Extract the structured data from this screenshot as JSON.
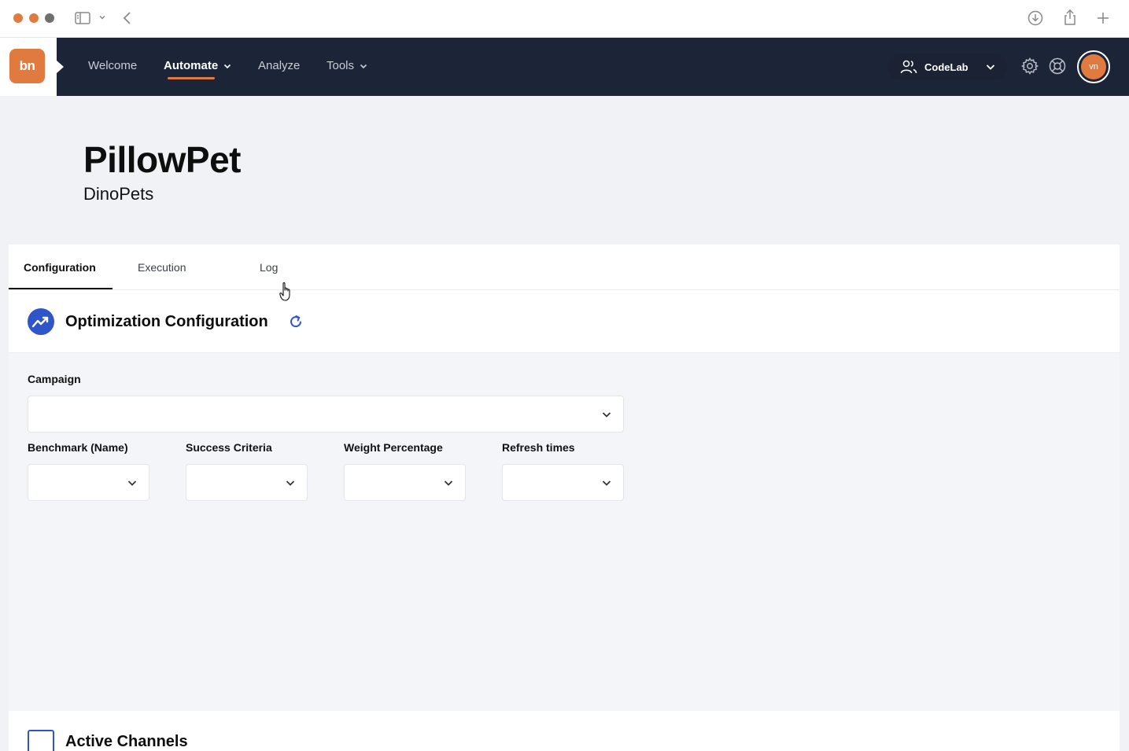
{
  "browser": {
    "icons": [
      "sidebar-toggle-icon",
      "chevron-down-icon",
      "back-arrow-icon",
      "download-icon",
      "share-icon",
      "new-tab-plus-icon"
    ]
  },
  "nav": {
    "logo_text": "bn",
    "items": [
      {
        "label": "Welcome",
        "active": false,
        "has_dropdown": false
      },
      {
        "label": "Automate",
        "active": true,
        "has_dropdown": true
      },
      {
        "label": "Analyze",
        "active": false,
        "has_dropdown": false
      },
      {
        "label": "Tools",
        "active": false,
        "has_dropdown": true
      }
    ],
    "org_name": "CodeLab",
    "avatar_initials": "vn",
    "icons": [
      "users-icon",
      "gear-icon",
      "lifebuoy-icon"
    ]
  },
  "header": {
    "title": "PillowPet",
    "subtitle": "DinoPets"
  },
  "tabs": [
    {
      "label": "Configuration",
      "active": true
    },
    {
      "label": "Execution",
      "active": false
    },
    {
      "label": "Log",
      "active": false
    }
  ],
  "section": {
    "title": "Optimization Configuration",
    "icon": "trending-up-icon",
    "refresh_icon": "refresh-icon"
  },
  "form": {
    "campaign_label": "Campaign",
    "campaign_value": "",
    "fields": [
      {
        "label": "Benchmark (Name)",
        "value": ""
      },
      {
        "label": "Success Criteria",
        "value": ""
      },
      {
        "label": "Weight Percentage",
        "value": ""
      },
      {
        "label": "Refresh times",
        "value": ""
      }
    ]
  },
  "active_channels": {
    "title": "Active Channels",
    "checked": false
  },
  "colors": {
    "accent": "#e07a3f",
    "nav_bg": "#1c2538",
    "primary_blue": "#2f55c8"
  }
}
